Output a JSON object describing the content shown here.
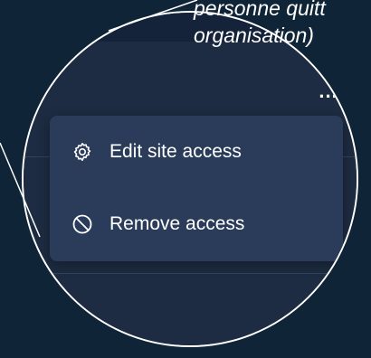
{
  "caption": {
    "line1": "personne quitt",
    "line2": "organisation)"
  },
  "toolbar": {
    "more_label": "..."
  },
  "menu": {
    "items": [
      {
        "label": "Edit site access",
        "icon": "gear-icon"
      },
      {
        "label": "Remove access",
        "icon": "prohibited-icon"
      }
    ]
  },
  "colors": {
    "background": "#0f2436",
    "panel": "#1d2c42",
    "menu": "#2a3c59",
    "text": "#ffffff"
  }
}
